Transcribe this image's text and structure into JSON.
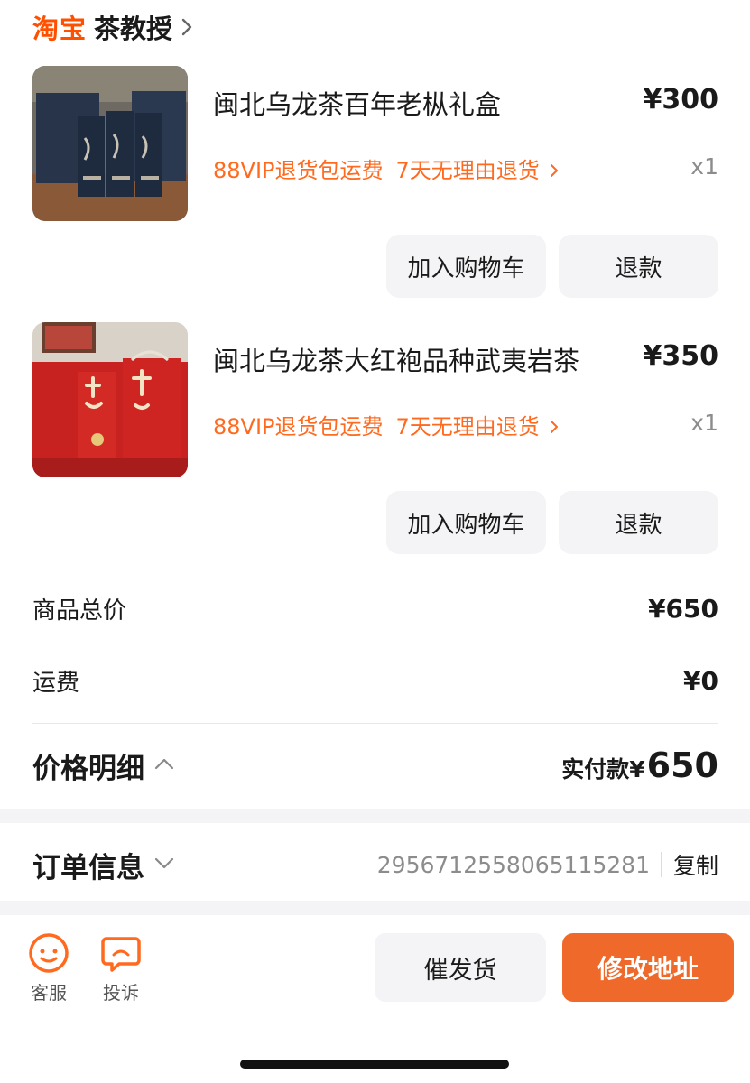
{
  "shop": {
    "brand": "淘宝",
    "name": "茶教授"
  },
  "products": [
    {
      "title": "闽北乌龙茶百年老枞礼盒",
      "price": "¥300",
      "tag_shipping": "88VIP退货包运费",
      "tag_return": "7天无理由退货",
      "qty": "x1",
      "add_cart_label": "加入购物车",
      "refund_label": "退款"
    },
    {
      "title": "闽北乌龙茶大红袍品种武夷岩茶",
      "price": "¥350",
      "tag_shipping": "88VIP退货包运费",
      "tag_return": "7天无理由退货",
      "qty": "x1",
      "add_cart_label": "加入购物车",
      "refund_label": "退款"
    }
  ],
  "summary": {
    "goods_total_label": "商品总价",
    "goods_total_value": "¥650",
    "shipping_label": "运费",
    "shipping_value": "¥0"
  },
  "price_detail": {
    "title": "价格明细",
    "paid_label": "实付款¥",
    "paid_amount": "650"
  },
  "order_info": {
    "title": "订单信息",
    "order_no": "2956712558065115281",
    "copy_label": "复制"
  },
  "bottom_bar": {
    "service_label": "客服",
    "complaint_label": "投诉",
    "urge_label": "催发货",
    "address_label": "修改地址"
  },
  "colors": {
    "brand": "#ff5000",
    "tag": "#ff6a1f",
    "primary_button": "#ef6a2a",
    "icon_orange": "#ff6a1f"
  }
}
